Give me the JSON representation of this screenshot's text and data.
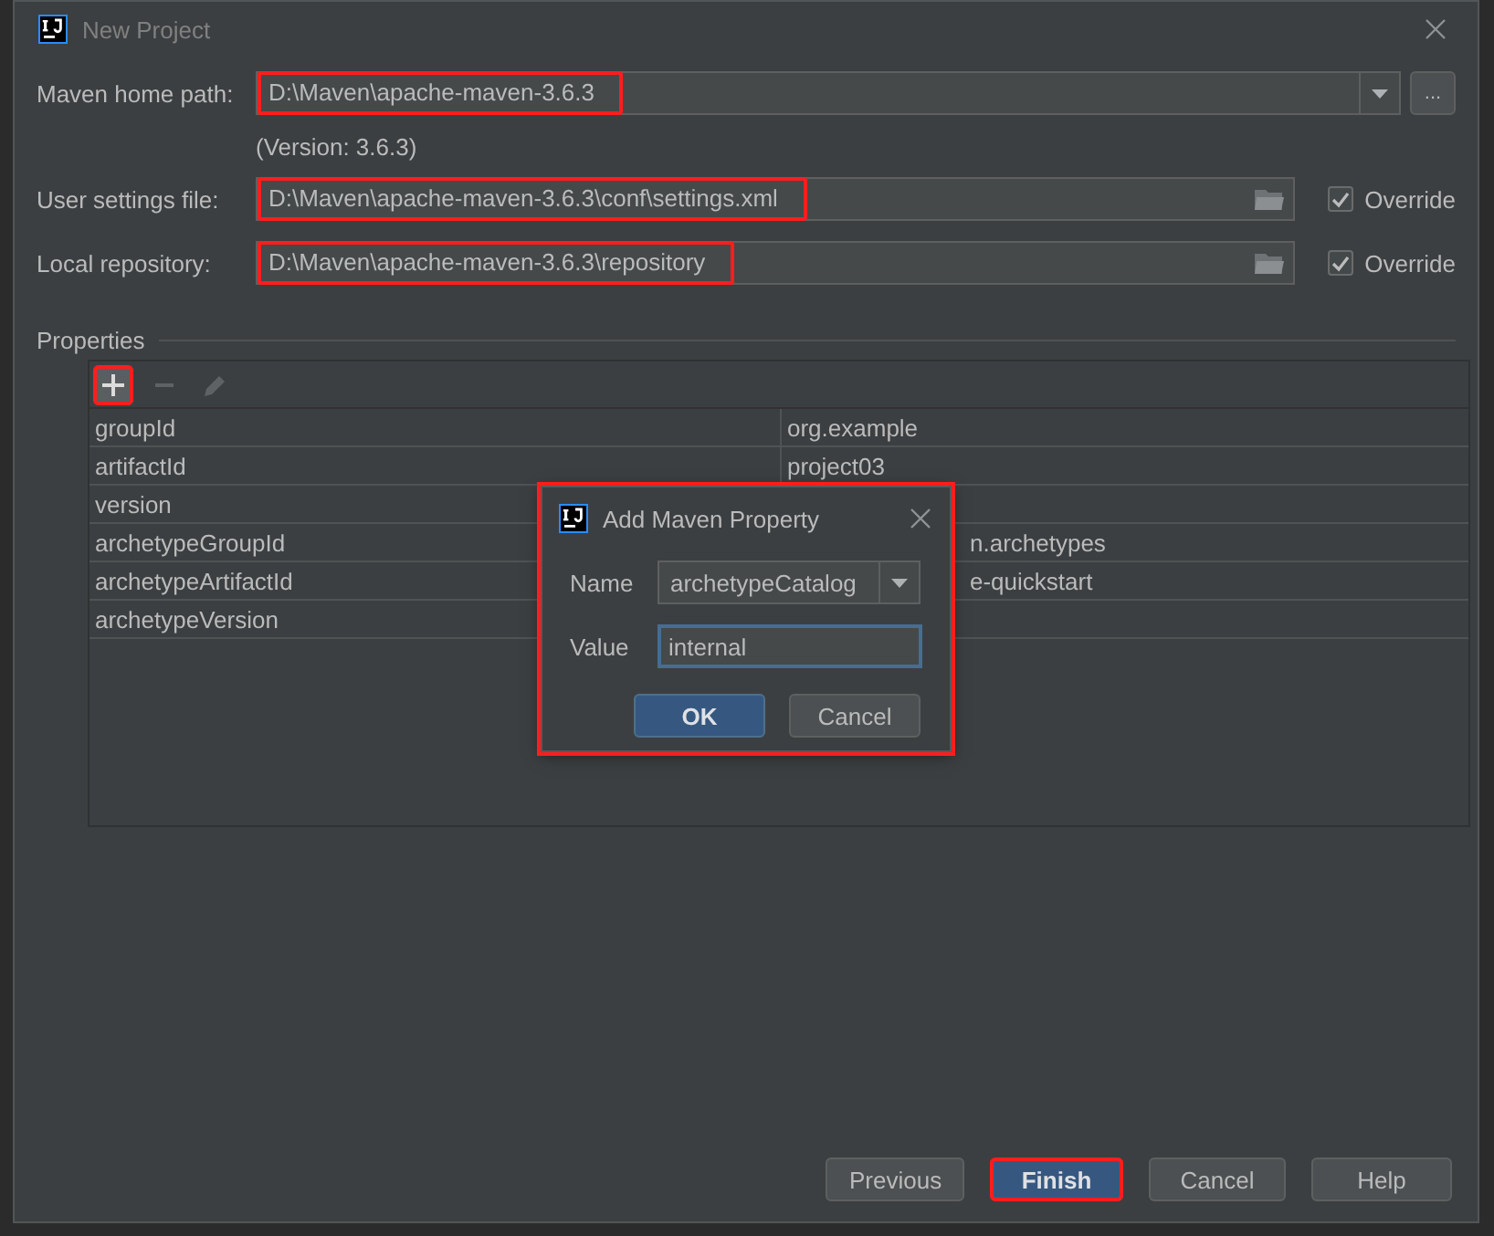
{
  "window": {
    "title": "New Project"
  },
  "fields": [
    {
      "kind": "combo",
      "label": "Maven home path:",
      "value": "D:\\Maven\\apache-maven-3.6.3",
      "highlighted": true,
      "browse_button": "...",
      "note": "(Version: 3.6.3)"
    },
    {
      "kind": "path",
      "label": "User settings file:",
      "value": "D:\\Maven\\apache-maven-3.6.3\\conf\\settings.xml",
      "highlighted": true,
      "override": {
        "label": "Override",
        "checked": true
      }
    },
    {
      "kind": "path",
      "label": "Local repository:",
      "value": "D:\\Maven\\apache-maven-3.6.3\\repository",
      "highlighted": true,
      "override": {
        "label": "Override",
        "checked": true
      }
    }
  ],
  "properties": {
    "title": "Properties",
    "toolbar": [
      {
        "kind": "add",
        "disabled": false,
        "highlighted": true
      },
      {
        "kind": "remove",
        "disabled": true,
        "highlighted": false
      },
      {
        "kind": "edit",
        "disabled": true,
        "highlighted": false
      }
    ],
    "rows": [
      {
        "name": "groupId",
        "value": "org.example"
      },
      {
        "name": "artifactId",
        "value": "project03"
      },
      {
        "name": "version"
      },
      {
        "name": "archetypeGroupId",
        "value": "n.archetypes",
        "clipped": true
      },
      {
        "name": "archetypeArtifactId",
        "value": "e-quickstart",
        "clipped": true
      },
      {
        "name": "archetypeVersion"
      }
    ]
  },
  "modal": {
    "title": "Add Maven Property",
    "highlighted": true,
    "name_label": "Name",
    "name_value": "archetypeCatalog",
    "value_label": "Value",
    "value": "internal",
    "buttons": [
      {
        "label": "OK",
        "default": true
      },
      {
        "label": "Cancel",
        "default": false
      }
    ]
  },
  "buttons": [
    {
      "label": "Previous",
      "default": false,
      "highlighted": false
    },
    {
      "label": "Finish",
      "default": true,
      "highlighted": true
    },
    {
      "label": "Cancel",
      "default": false,
      "highlighted": false
    },
    {
      "label": "Help",
      "default": false,
      "highlighted": false
    }
  ]
}
